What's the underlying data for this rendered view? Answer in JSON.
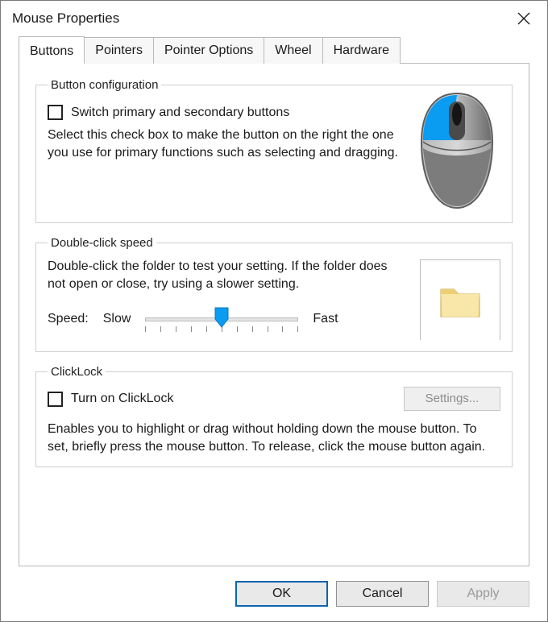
{
  "window": {
    "title": "Mouse Properties"
  },
  "tabs": [
    {
      "label": "Buttons",
      "active": true
    },
    {
      "label": "Pointers",
      "active": false
    },
    {
      "label": "Pointer Options",
      "active": false
    },
    {
      "label": "Wheel",
      "active": false
    },
    {
      "label": "Hardware",
      "active": false
    }
  ],
  "button_config": {
    "legend": "Button configuration",
    "checkbox_label": "Switch primary and secondary buttons",
    "checkbox_checked": false,
    "description": "Select this check box to make the button on the right the one you use for primary functions such as selecting and dragging."
  },
  "double_click": {
    "legend": "Double-click speed",
    "description": "Double-click the folder to test your setting. If the folder does not open or close, try using a slower setting.",
    "speed_label": "Speed:",
    "slow_label": "Slow",
    "fast_label": "Fast",
    "slider": {
      "min": 0,
      "max": 10,
      "value": 5,
      "ticks": 11
    }
  },
  "clicklock": {
    "legend": "ClickLock",
    "checkbox_label": "Turn on ClickLock",
    "checkbox_checked": false,
    "settings_button": "Settings...",
    "settings_enabled": false,
    "description": "Enables you to highlight or drag without holding down the mouse button. To set, briefly press the mouse button. To release, click the mouse button again."
  },
  "buttons": {
    "ok": "OK",
    "cancel": "Cancel",
    "apply": "Apply",
    "apply_enabled": false
  },
  "colors": {
    "accent": "#0a9cf1",
    "focus_border": "#0a64ad"
  },
  "icons": {
    "close": "close-icon",
    "mouse": "mouse-illustration-icon",
    "folder": "folder-icon",
    "slider_thumb": "slider-thumb-icon"
  }
}
